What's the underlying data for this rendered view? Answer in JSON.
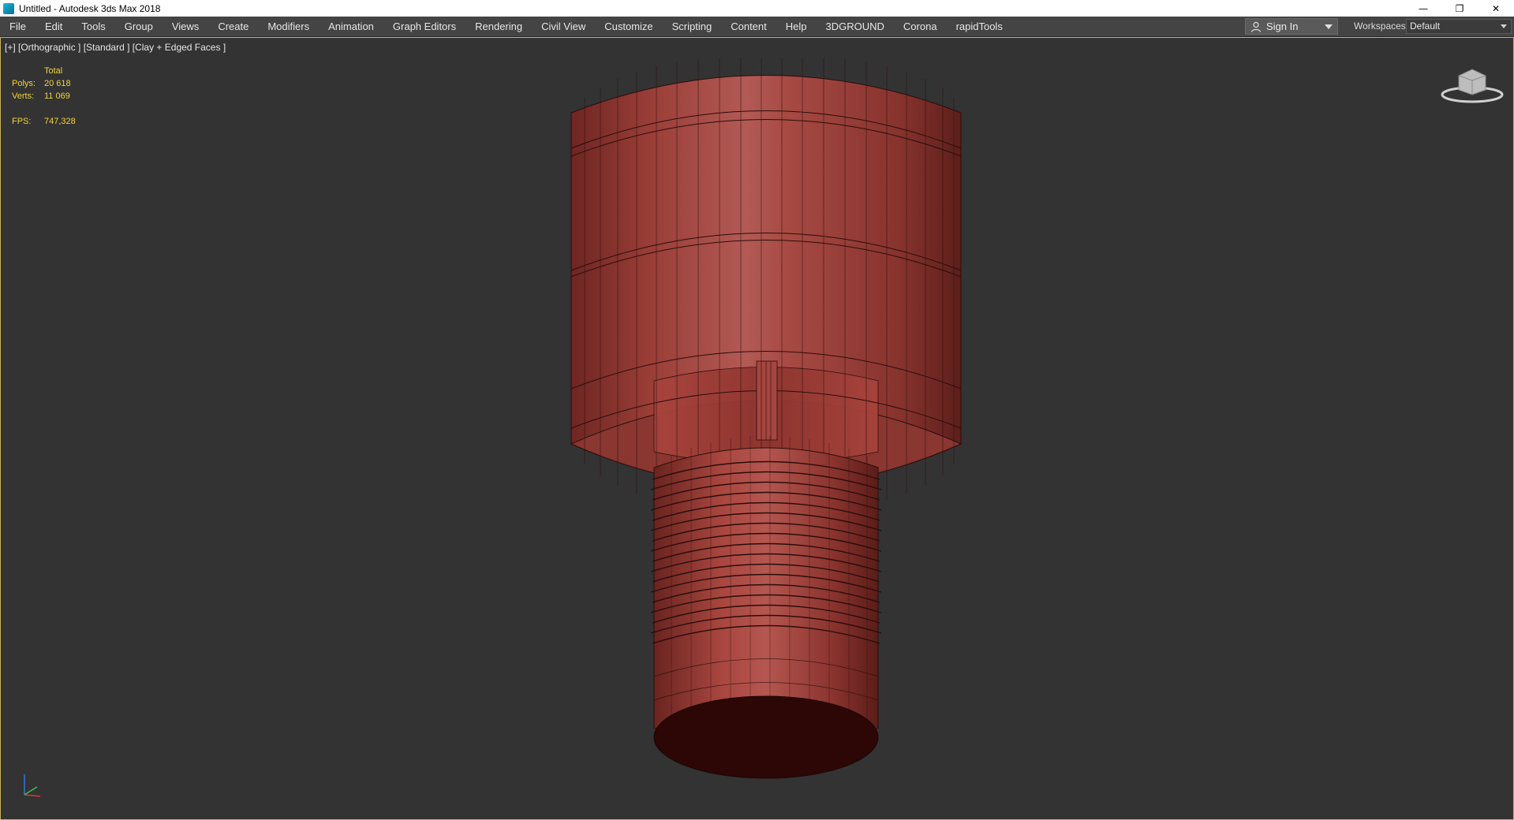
{
  "window": {
    "title": "Untitled - Autodesk 3ds Max 2018",
    "minimize": "—",
    "restore": "❐",
    "close": "✕"
  },
  "menu": {
    "items": [
      "File",
      "Edit",
      "Tools",
      "Group",
      "Views",
      "Create",
      "Modifiers",
      "Animation",
      "Graph Editors",
      "Rendering",
      "Civil View",
      "Customize",
      "Scripting",
      "Content",
      "Help",
      "3DGROUND",
      "Corona",
      "rapidTools"
    ]
  },
  "account": {
    "sign_in": "Sign In"
  },
  "workspaces": {
    "label": "Workspaces:",
    "value": "Default"
  },
  "viewport": {
    "label": "[+] [Orthographic ] [Standard ] [Clay + Edged Faces ]",
    "stats": {
      "total_label": "Total",
      "polys_label": "Polys:",
      "polys_value": "20 618",
      "verts_label": "Verts:",
      "verts_value": "11 069",
      "fps_label": "FPS:",
      "fps_value": "747,328"
    },
    "model_color": "#a0403a",
    "background": "#333333",
    "border_color": "#c9b35a"
  },
  "icons": {
    "app": "3dsmax-app-icon",
    "user": "user-icon",
    "viewcube": "viewcube-icon",
    "axis": "axis-tripod-icon"
  }
}
